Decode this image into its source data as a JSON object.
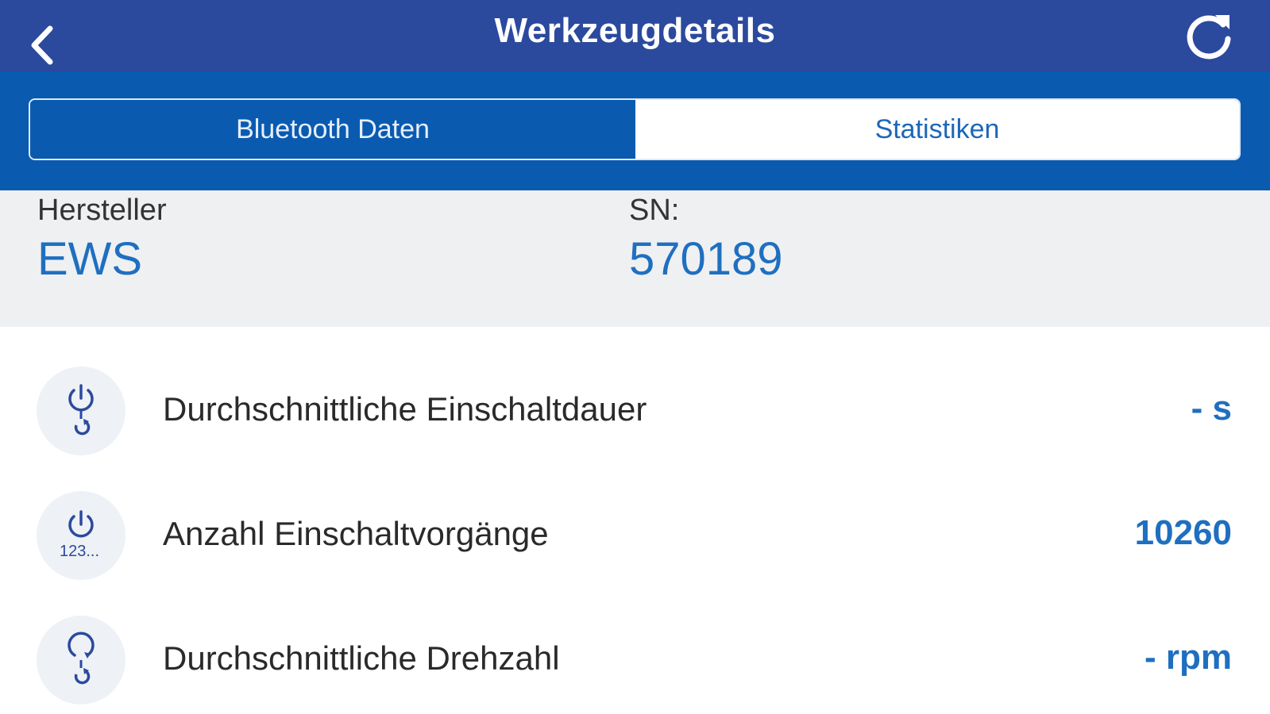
{
  "navbar": {
    "title": "Werkzeugdetails",
    "back_icon": "chevron-left-icon",
    "refresh_icon": "refresh-icon"
  },
  "tabs": [
    {
      "label": "Bluetooth Daten",
      "selected": true
    },
    {
      "label": "Statistiken",
      "selected": false
    }
  ],
  "info": {
    "manufacturer_label": "Hersteller",
    "manufacturer_value": "EWS",
    "serial_label": "SN:",
    "serial_value": "570189"
  },
  "stats": [
    {
      "icon": "power-torque-icon",
      "label": "Durchschnittliche Einschaltdauer",
      "value": "- s"
    },
    {
      "icon": "power-count-icon",
      "label": "Anzahl Einschaltvorgänge",
      "value": "10260"
    },
    {
      "icon": "rotation-speed-icon",
      "label": "Durchschnittliche Drehzahl",
      "value": "- rpm"
    }
  ],
  "colors": {
    "navbar": "#2b4a9e",
    "band": "#0a5bb0",
    "accent": "#1f6fc0",
    "info_bg": "#eff0f2"
  }
}
